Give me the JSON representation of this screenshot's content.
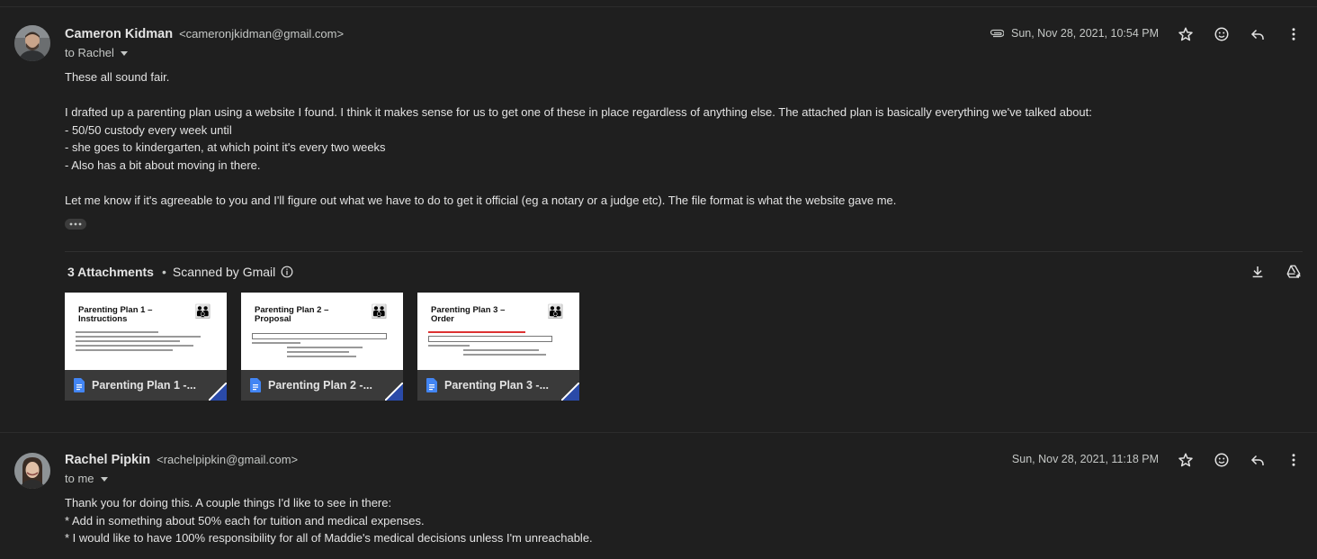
{
  "messages": [
    {
      "sender_name": "Cameron Kidman",
      "sender_email": "<cameronjkidman@gmail.com>",
      "recipient": "to Rachel",
      "date": "Sun, Nov 28, 2021, 10:54 PM",
      "has_attachment": true,
      "body": "These all sound fair.\n\nI drafted up a parenting plan using a website I found. I think it makes sense for us to get one of these in place regardless of anything else. The attached plan is basically everything we've talked about:\n- 50/50 custody every week until\n- she goes to kindergarten, at which point it's every two weeks\n- Also has a bit about moving in there.\n\nLet me know if it's agreeable to you and I'll figure out what we have to do to get it official (eg a notary or a judge etc). The file format is what the website gave me.",
      "attachments_header": {
        "count_label": "3 Attachments",
        "separator": "•",
        "scanned_label": "Scanned by Gmail"
      },
      "attachments": [
        {
          "name": "Parenting Plan 1 -...",
          "thumb_title": "Parenting Plan 1 – Instructions"
        },
        {
          "name": "Parenting Plan 2 -...",
          "thumb_title": "Parenting Plan 2 – Proposal"
        },
        {
          "name": "Parenting Plan 3 -...",
          "thumb_title": "Parenting Plan 3 – Order"
        }
      ]
    },
    {
      "sender_name": "Rachel Pipkin",
      "sender_email": "<rachelpipkin@gmail.com>",
      "recipient": "to me",
      "date": "Sun, Nov 28, 2021, 11:18 PM",
      "body": "Thank you for doing this. A couple things I'd like to see in there:\n* Add in something about 50% each for tuition and medical expenses.\n* I would like to have 100% responsibility for all of Maddie's medical decisions unless I'm unreachable."
    }
  ],
  "icons": {
    "attachment": "paperclip-icon",
    "star": "star-icon",
    "react": "emoji-icon",
    "reply": "reply-icon",
    "more": "more-vert-icon",
    "download": "download-icon",
    "drive": "add-to-drive-icon",
    "info": "info-icon",
    "doc": "google-docs-icon"
  },
  "colors": {
    "background": "#1f1f1f",
    "text": "#e3e3e3",
    "doc_blue": "#4285f4",
    "corner_blue": "#2a4aa8"
  }
}
